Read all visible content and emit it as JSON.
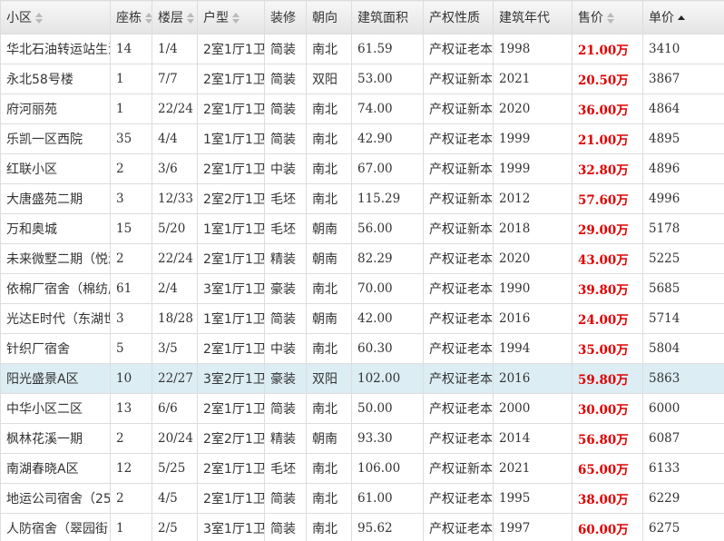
{
  "columns": [
    "小区",
    "座栋",
    "楼层",
    "户型",
    "装修",
    "朝向",
    "建筑面积",
    "产权性质",
    "建筑年代",
    "售价",
    "单价"
  ],
  "rows": [
    [
      "华北石油转运站生活",
      "14",
      "1/4",
      "2室1厅1卫",
      "简装",
      "南北",
      "61.59",
      "产权证老本",
      "1998",
      "21.00万",
      "3410"
    ],
    [
      "永北58号楼",
      "1",
      "7/7",
      "2室1厅1卫",
      "简装",
      "双阳",
      "53.00",
      "产权证新本",
      "2021",
      "20.50万",
      "3867"
    ],
    [
      "府河丽苑",
      "1",
      "22/24",
      "2室1厅1卫",
      "简装",
      "南北",
      "74.00",
      "产权证新本",
      "2020",
      "36.00万",
      "4864"
    ],
    [
      "乐凯一区西院",
      "35",
      "4/4",
      "1室1厅1卫",
      "简装",
      "南北",
      "42.90",
      "产权证老本",
      "1999",
      "21.00万",
      "4895"
    ],
    [
      "红联小区",
      "2",
      "3/6",
      "2室1厅1卫",
      "中装",
      "南北",
      "67.00",
      "产权证新本",
      "1999",
      "32.80万",
      "4896"
    ],
    [
      "大唐盛苑二期",
      "3",
      "12/33",
      "2室2厅1卫",
      "毛坯",
      "南北",
      "115.29",
      "产权证新本",
      "2012",
      "57.60万",
      "4996"
    ],
    [
      "万和奥城",
      "15",
      "5/20",
      "1室1厅1卫",
      "毛坯",
      "朝南",
      "56.00",
      "产权证新本",
      "2018",
      "29.00万",
      "5178"
    ],
    [
      "未来微墅二期（悦澜",
      "2",
      "22/24",
      "2室1厅1卫",
      "精装",
      "朝南",
      "82.29",
      "产权证老本",
      "2020",
      "43.00万",
      "5225"
    ],
    [
      "依棉厂宿舍（棉纺厂",
      "61",
      "2/4",
      "3室1厅1卫",
      "豪装",
      "南北",
      "70.00",
      "产权证老本",
      "1990",
      "39.80万",
      "5685"
    ],
    [
      "光达E时代（东湖世",
      "3",
      "18/28",
      "1室1厅1卫",
      "简装",
      "朝南",
      "42.00",
      "产权证老本",
      "2016",
      "24.00万",
      "5714"
    ],
    [
      "针织厂宿舍",
      "5",
      "3/5",
      "2室1厅1卫",
      "中装",
      "南北",
      "60.30",
      "产权证老本",
      "1994",
      "35.00万",
      "5804"
    ],
    [
      "阳光盛景A区",
      "10",
      "22/27",
      "3室2厅1卫",
      "豪装",
      "双阳",
      "102.00",
      "产权证老本",
      "2016",
      "59.80万",
      "5863"
    ],
    [
      "中华小区二区",
      "13",
      "6/6",
      "2室1厅1卫",
      "简装",
      "南北",
      "50.00",
      "产权证老本",
      "2000",
      "30.00万",
      "6000"
    ],
    [
      "枫林花溪一期",
      "2",
      "20/24",
      "2室2厅1卫",
      "精装",
      "朝南",
      "93.30",
      "产权证老本",
      "2014",
      "56.80万",
      "6087"
    ],
    [
      "南湖春晓A区",
      "12",
      "5/25",
      "2室1厅1卫",
      "毛坯",
      "南北",
      "106.00",
      "产权证新本",
      "2021",
      "65.00万",
      "6133"
    ],
    [
      "地运公司宿舍（25",
      "2",
      "4/5",
      "2室1厅1卫",
      "简装",
      "南北",
      "61.00",
      "产权证老本",
      "1995",
      "38.00万",
      "6229"
    ],
    [
      "人防宿舍（翠园街",
      "1",
      "2/5",
      "3室1厅1卫",
      "简装",
      "南北",
      "95.62",
      "产权证老本",
      "1997",
      "60.00万",
      "6275"
    ]
  ],
  "selected_row": 11,
  "sorted_column": 10,
  "colors": {
    "price": "#e00000",
    "selected": "#dcedf4",
    "header": "#ececec"
  }
}
